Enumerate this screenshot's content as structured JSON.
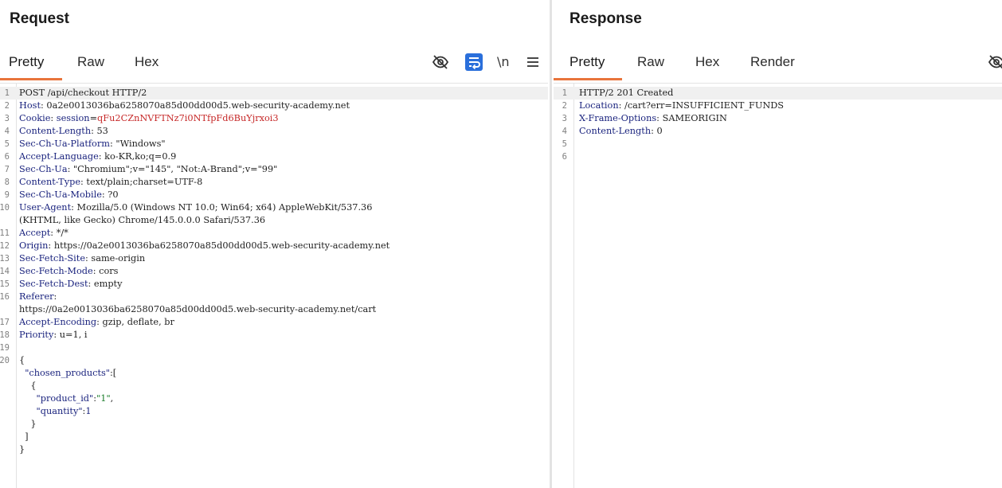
{
  "request": {
    "title": "Request",
    "tabs": [
      "Pretty",
      "Raw",
      "Hex"
    ],
    "active_tab": "Pretty",
    "lines": [
      {
        "n": "1",
        "text": "POST /api/checkout HTTP/2"
      },
      {
        "n": "2",
        "key": "Host",
        "value": "0a2e0013036ba6258070a85d00dd00d5.web-security-academy.net"
      },
      {
        "n": "3",
        "key": "Cookie",
        "cookie_name": "session",
        "cookie_value": "qFu2CZnNVFTNz7i0NTfpFd6BuYjrxoi3"
      },
      {
        "n": "4",
        "key": "Content-Length",
        "value": "53"
      },
      {
        "n": "5",
        "key": "Sec-Ch-Ua-Platform",
        "value": "\"Windows\""
      },
      {
        "n": "6",
        "key": "Accept-Language",
        "value": "ko-KR,ko;q=0.9"
      },
      {
        "n": "7",
        "key": "Sec-Ch-Ua",
        "value": "\"Chromium\";v=\"145\", \"Not:A-Brand\";v=\"99\""
      },
      {
        "n": "8",
        "key": "Content-Type",
        "value": "text/plain;charset=UTF-8"
      },
      {
        "n": "9",
        "key": "Sec-Ch-Ua-Mobile",
        "value": "?0"
      },
      {
        "n": "10",
        "key": "User-Agent",
        "value": "Mozilla/5.0 (Windows NT 10.0; Win64; x64) AppleWebKit/537.36"
      },
      {
        "n": "",
        "text": "(KHTML, like Gecko) Chrome/145.0.0.0 Safari/537.36"
      },
      {
        "n": "11",
        "key": "Accept",
        "value": "*/*"
      },
      {
        "n": "12",
        "key": "Origin",
        "value": "https://0a2e0013036ba6258070a85d00dd00d5.web-security-academy.net"
      },
      {
        "n": "13",
        "key": "Sec-Fetch-Site",
        "value": "same-origin"
      },
      {
        "n": "14",
        "key": "Sec-Fetch-Mode",
        "value": "cors"
      },
      {
        "n": "15",
        "key": "Sec-Fetch-Dest",
        "value": "empty"
      },
      {
        "n": "16",
        "key": "Referer",
        "value": ""
      },
      {
        "n": "",
        "text": "https://0a2e0013036ba6258070a85d00dd00d5.web-security-academy.net/cart"
      },
      {
        "n": "17",
        "key": "Accept-Encoding",
        "value": "gzip, deflate, br"
      },
      {
        "n": "18",
        "key": "Priority",
        "value": "u=1, i"
      },
      {
        "n": "19",
        "text": ""
      },
      {
        "n": "20",
        "json": [
          {
            "p": "{"
          }
        ]
      },
      {
        "n": "",
        "json": [
          {
            "p": "  "
          },
          {
            "k": "\"chosen_products\""
          },
          {
            "p": ":["
          }
        ]
      },
      {
        "n": "",
        "json": [
          {
            "p": "    {"
          }
        ]
      },
      {
        "n": "",
        "json": [
          {
            "p": "      "
          },
          {
            "k": "\"product_id\""
          },
          {
            "p": ":"
          },
          {
            "s": "\"1\""
          },
          {
            "p": ","
          }
        ]
      },
      {
        "n": "",
        "json": [
          {
            "p": "      "
          },
          {
            "k": "\"quantity\""
          },
          {
            "p": ":"
          },
          {
            "num": "1"
          }
        ]
      },
      {
        "n": "",
        "json": [
          {
            "p": "    }"
          }
        ]
      },
      {
        "n": "",
        "json": [
          {
            "p": "  ]"
          }
        ]
      },
      {
        "n": "",
        "json": [
          {
            "p": "}"
          }
        ]
      }
    ]
  },
  "response": {
    "title": "Response",
    "tabs": [
      "Pretty",
      "Raw",
      "Hex",
      "Render"
    ],
    "active_tab": "Pretty",
    "lines": [
      {
        "n": "1",
        "text": "HTTP/2 201 Created"
      },
      {
        "n": "2",
        "key": "Location",
        "value": "/cart?err=INSUFFICIENT_FUNDS"
      },
      {
        "n": "3",
        "key": "X-Frame-Options",
        "value": "SAMEORIGIN"
      },
      {
        "n": "4",
        "key": "Content-Length",
        "value": "0"
      },
      {
        "n": "5",
        "text": ""
      },
      {
        "n": "6",
        "text": ""
      }
    ]
  },
  "toolbar": {
    "hide_icon": "eye-slash-icon",
    "wrap_icon": "word-wrap-icon",
    "newline_label": "\\n",
    "menu_icon": "hamburger-menu-icon"
  },
  "colors": {
    "accent": "#e8743b",
    "wrap_button": "#2a6fdb"
  }
}
